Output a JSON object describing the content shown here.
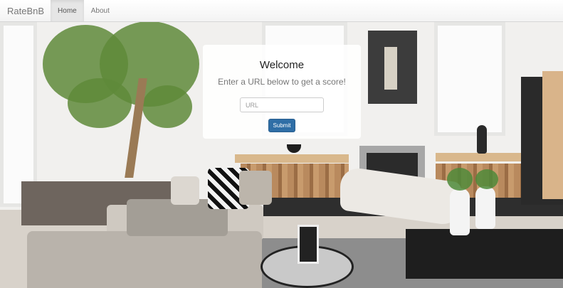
{
  "navbar": {
    "brand": "RateBnB",
    "items": [
      {
        "label": "Home",
        "active": true
      },
      {
        "label": "About",
        "active": false
      }
    ]
  },
  "welcome": {
    "title": "Welcome",
    "subtitle": "Enter a URL below to get a score!",
    "url_placeholder": "URL",
    "url_value": "",
    "submit_label": "Submit"
  },
  "colors": {
    "submit_button": "#2f6ea6",
    "navbar_bg": "#f8f8f8",
    "active_nav_bg": "#e6e6e6"
  }
}
